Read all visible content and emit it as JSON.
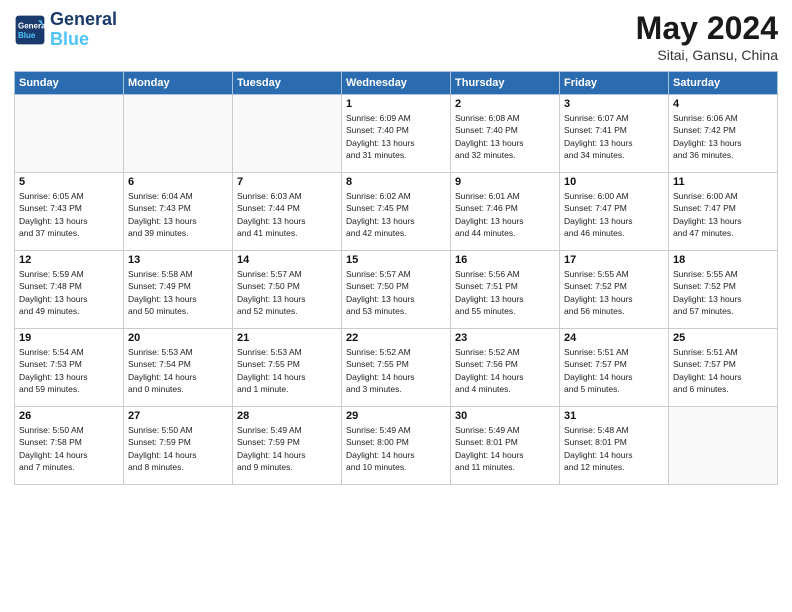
{
  "header": {
    "logo_line1": "General",
    "logo_line2": "Blue",
    "month": "May 2024",
    "location": "Sitai, Gansu, China"
  },
  "weekdays": [
    "Sunday",
    "Monday",
    "Tuesday",
    "Wednesday",
    "Thursday",
    "Friday",
    "Saturday"
  ],
  "weeks": [
    [
      {
        "day": "",
        "info": ""
      },
      {
        "day": "",
        "info": ""
      },
      {
        "day": "",
        "info": ""
      },
      {
        "day": "1",
        "info": "Sunrise: 6:09 AM\nSunset: 7:40 PM\nDaylight: 13 hours\nand 31 minutes."
      },
      {
        "day": "2",
        "info": "Sunrise: 6:08 AM\nSunset: 7:40 PM\nDaylight: 13 hours\nand 32 minutes."
      },
      {
        "day": "3",
        "info": "Sunrise: 6:07 AM\nSunset: 7:41 PM\nDaylight: 13 hours\nand 34 minutes."
      },
      {
        "day": "4",
        "info": "Sunrise: 6:06 AM\nSunset: 7:42 PM\nDaylight: 13 hours\nand 36 minutes."
      }
    ],
    [
      {
        "day": "5",
        "info": "Sunrise: 6:05 AM\nSunset: 7:43 PM\nDaylight: 13 hours\nand 37 minutes."
      },
      {
        "day": "6",
        "info": "Sunrise: 6:04 AM\nSunset: 7:43 PM\nDaylight: 13 hours\nand 39 minutes."
      },
      {
        "day": "7",
        "info": "Sunrise: 6:03 AM\nSunset: 7:44 PM\nDaylight: 13 hours\nand 41 minutes."
      },
      {
        "day": "8",
        "info": "Sunrise: 6:02 AM\nSunset: 7:45 PM\nDaylight: 13 hours\nand 42 minutes."
      },
      {
        "day": "9",
        "info": "Sunrise: 6:01 AM\nSunset: 7:46 PM\nDaylight: 13 hours\nand 44 minutes."
      },
      {
        "day": "10",
        "info": "Sunrise: 6:00 AM\nSunset: 7:47 PM\nDaylight: 13 hours\nand 46 minutes."
      },
      {
        "day": "11",
        "info": "Sunrise: 6:00 AM\nSunset: 7:47 PM\nDaylight: 13 hours\nand 47 minutes."
      }
    ],
    [
      {
        "day": "12",
        "info": "Sunrise: 5:59 AM\nSunset: 7:48 PM\nDaylight: 13 hours\nand 49 minutes."
      },
      {
        "day": "13",
        "info": "Sunrise: 5:58 AM\nSunset: 7:49 PM\nDaylight: 13 hours\nand 50 minutes."
      },
      {
        "day": "14",
        "info": "Sunrise: 5:57 AM\nSunset: 7:50 PM\nDaylight: 13 hours\nand 52 minutes."
      },
      {
        "day": "15",
        "info": "Sunrise: 5:57 AM\nSunset: 7:50 PM\nDaylight: 13 hours\nand 53 minutes."
      },
      {
        "day": "16",
        "info": "Sunrise: 5:56 AM\nSunset: 7:51 PM\nDaylight: 13 hours\nand 55 minutes."
      },
      {
        "day": "17",
        "info": "Sunrise: 5:55 AM\nSunset: 7:52 PM\nDaylight: 13 hours\nand 56 minutes."
      },
      {
        "day": "18",
        "info": "Sunrise: 5:55 AM\nSunset: 7:52 PM\nDaylight: 13 hours\nand 57 minutes."
      }
    ],
    [
      {
        "day": "19",
        "info": "Sunrise: 5:54 AM\nSunset: 7:53 PM\nDaylight: 13 hours\nand 59 minutes."
      },
      {
        "day": "20",
        "info": "Sunrise: 5:53 AM\nSunset: 7:54 PM\nDaylight: 14 hours\nand 0 minutes."
      },
      {
        "day": "21",
        "info": "Sunrise: 5:53 AM\nSunset: 7:55 PM\nDaylight: 14 hours\nand 1 minute."
      },
      {
        "day": "22",
        "info": "Sunrise: 5:52 AM\nSunset: 7:55 PM\nDaylight: 14 hours\nand 3 minutes."
      },
      {
        "day": "23",
        "info": "Sunrise: 5:52 AM\nSunset: 7:56 PM\nDaylight: 14 hours\nand 4 minutes."
      },
      {
        "day": "24",
        "info": "Sunrise: 5:51 AM\nSunset: 7:57 PM\nDaylight: 14 hours\nand 5 minutes."
      },
      {
        "day": "25",
        "info": "Sunrise: 5:51 AM\nSunset: 7:57 PM\nDaylight: 14 hours\nand 6 minutes."
      }
    ],
    [
      {
        "day": "26",
        "info": "Sunrise: 5:50 AM\nSunset: 7:58 PM\nDaylight: 14 hours\nand 7 minutes."
      },
      {
        "day": "27",
        "info": "Sunrise: 5:50 AM\nSunset: 7:59 PM\nDaylight: 14 hours\nand 8 minutes."
      },
      {
        "day": "28",
        "info": "Sunrise: 5:49 AM\nSunset: 7:59 PM\nDaylight: 14 hours\nand 9 minutes."
      },
      {
        "day": "29",
        "info": "Sunrise: 5:49 AM\nSunset: 8:00 PM\nDaylight: 14 hours\nand 10 minutes."
      },
      {
        "day": "30",
        "info": "Sunrise: 5:49 AM\nSunset: 8:01 PM\nDaylight: 14 hours\nand 11 minutes."
      },
      {
        "day": "31",
        "info": "Sunrise: 5:48 AM\nSunset: 8:01 PM\nDaylight: 14 hours\nand 12 minutes."
      },
      {
        "day": "",
        "info": ""
      }
    ]
  ]
}
